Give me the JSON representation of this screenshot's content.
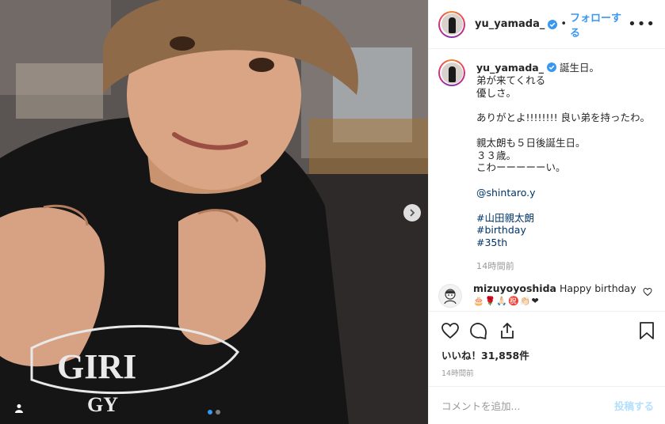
{
  "post": {
    "username": "yu_yamada_",
    "follow_label": "フォローする",
    "separator": "•",
    "more_label": "•••",
    "caption_lines": [
      "誕生日。",
      "弟が来てくれる",
      "優しさ。",
      "",
      "ありがとよ!!!!!!!! 良い弟を持ったわ。",
      "",
      "親太朗も５日後誕生日。",
      "３３歳。",
      "こわーーーーーい。"
    ],
    "mention": "@shintaro.y",
    "hashtags": [
      "#山田親太朗",
      "#birthday",
      "#35th"
    ],
    "caption_time": "14時間前",
    "photo_shirt_text_1": "GIRI",
    "photo_shirt_text_2": "GY"
  },
  "comment": {
    "username": "mizuyoyoshida",
    "text": "Happy birthday",
    "emojis": "🎂🌹🙏🏻㊗️👏🏻❤"
  },
  "footer": {
    "likes": "いいね！31,858件",
    "timestamp": "14時間前",
    "comment_placeholder": "コメントを追加...",
    "post_label": "投稿する"
  },
  "colors": {
    "link": "#3897f0",
    "hashtag": "#003569",
    "muted": "#999999",
    "active_dot": "#3897f0"
  },
  "icons": [
    "chevron-right-icon",
    "user-tag-icon",
    "verified-badge-icon",
    "heart-icon",
    "comment-icon",
    "share-icon",
    "bookmark-icon"
  ]
}
